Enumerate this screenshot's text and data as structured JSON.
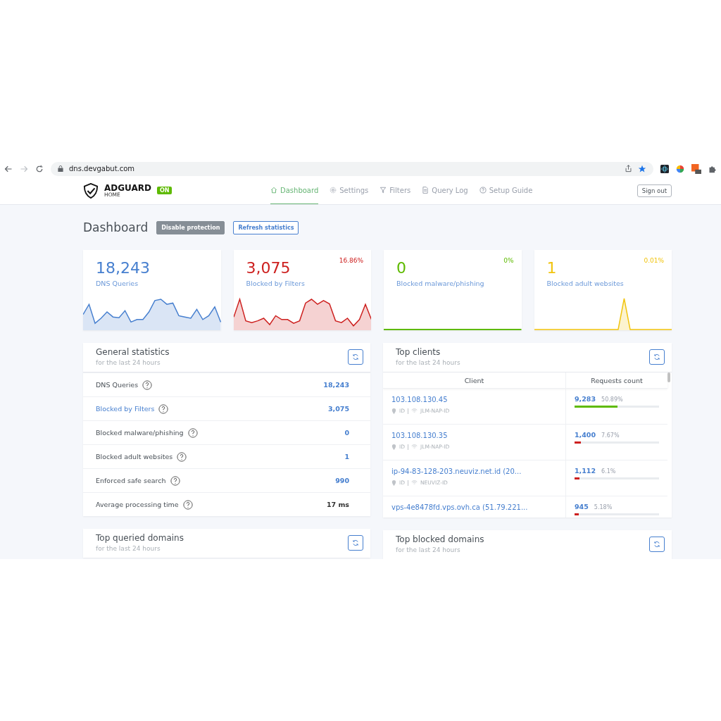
{
  "browser": {
    "url": "dns.devgabut.com"
  },
  "header": {
    "brand": "ADGUARD",
    "brand_sub": "HOME",
    "status_badge": "ON",
    "sign_out": "Sign out",
    "nav": [
      {
        "label": "Dashboard",
        "selected": true
      },
      {
        "label": "Settings",
        "selected": false
      },
      {
        "label": "Filters",
        "selected": false
      },
      {
        "label": "Query Log",
        "selected": false
      },
      {
        "label": "Setup Guide",
        "selected": false
      }
    ]
  },
  "page": {
    "title": "Dashboard",
    "buttons": [
      {
        "label": "Disable protection",
        "kind": "solid"
      },
      {
        "label": "Refresh statistics",
        "kind": "outline"
      }
    ]
  },
  "stat_cards": [
    {
      "value": "18,243",
      "label": "DNS Queries",
      "color": "#467fcf"
    },
    {
      "value": "3,075",
      "label": "Blocked by Filters",
      "percent": "16.86%",
      "color": "#cd201f"
    },
    {
      "value": "0",
      "label": "Blocked malware/phishing",
      "percent": "0%",
      "color": "#5eba00"
    },
    {
      "value": "1",
      "label": "Blocked adult websites",
      "percent": "0.01%",
      "color": "#f1c40f"
    }
  ],
  "general_statistics": {
    "title": "General statistics",
    "subtitle": "for the last 24 hours",
    "rows": [
      {
        "label": "DNS Queries",
        "value": "18,243",
        "highlight": false,
        "link": true
      },
      {
        "label": "Blocked by Filters",
        "value": "3,075",
        "highlight": true,
        "link": true
      },
      {
        "label": "Blocked malware/phishing",
        "value": "0",
        "highlight": false,
        "link": true
      },
      {
        "label": "Blocked adult websites",
        "value": "1",
        "highlight": false,
        "link": true
      },
      {
        "label": "Enforced safe search",
        "value": "990",
        "highlight": false,
        "link": true
      },
      {
        "label": "Average processing time",
        "value": "17 ms",
        "highlight": false,
        "link": false
      }
    ]
  },
  "top_clients": {
    "title": "Top clients",
    "subtitle": "for the last 24 hours",
    "columns": [
      "Client",
      "Requests count"
    ],
    "rows": [
      {
        "client": "103.108.130.45",
        "country": "ID",
        "network": "JLM-NAP-ID",
        "count": "9,283",
        "percent": "50.89%",
        "level": 0.5089,
        "color": "#5eba00"
      },
      {
        "client": "103.108.130.35",
        "country": "ID",
        "network": "JLM-NAP-ID",
        "count": "1,400",
        "percent": "7.67%",
        "level": 0.0767,
        "color": "#cd201f"
      },
      {
        "client": "ip-94-83-128-203.neuviz.net.id (20...",
        "country": "ID",
        "network": "NEUVIZ-ID",
        "count": "1,112",
        "percent": "6.1%",
        "level": 0.061,
        "color": "#cd201f"
      },
      {
        "client": "vps-4e8478fd.vps.ovh.ca (51.79.221...",
        "count": "945",
        "percent": "5.18%",
        "level": 0.0518,
        "color": "#cd201f"
      }
    ]
  },
  "bottom_cards": [
    {
      "title": "Top queried domains",
      "subtitle": "for the last 24 hours"
    },
    {
      "title": "Top blocked domains",
      "subtitle": "for the last 24 hours"
    }
  ]
}
